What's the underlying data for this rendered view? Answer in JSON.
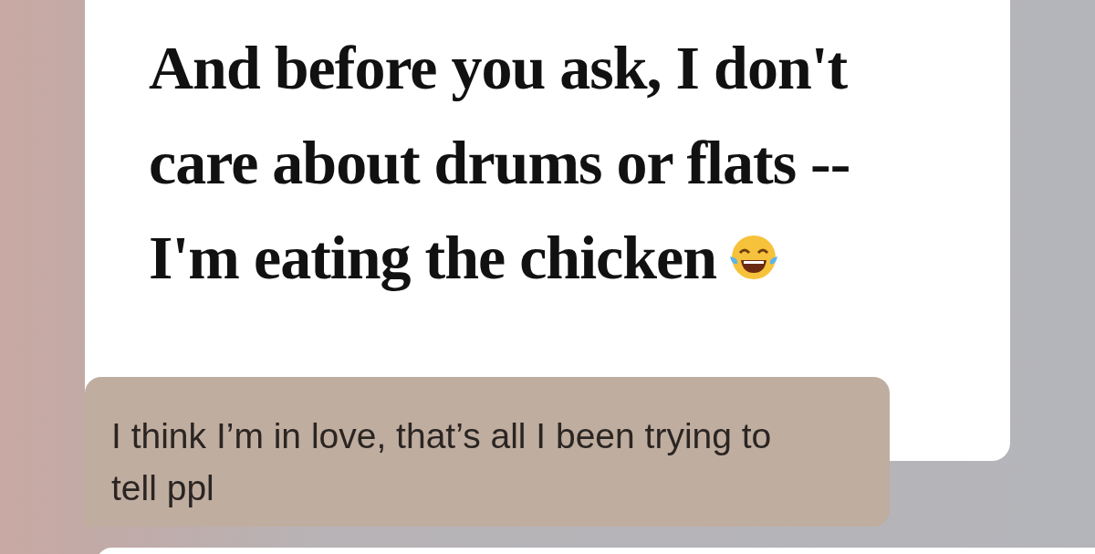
{
  "post": {
    "lines": [
      "And before you ask, I don't",
      "care about drums or flats --",
      "I'm eating the chicken"
    ]
  },
  "reply": {
    "lines": [
      "I think I’m in love, that’s all I been trying to",
      "tell ppl"
    ]
  }
}
